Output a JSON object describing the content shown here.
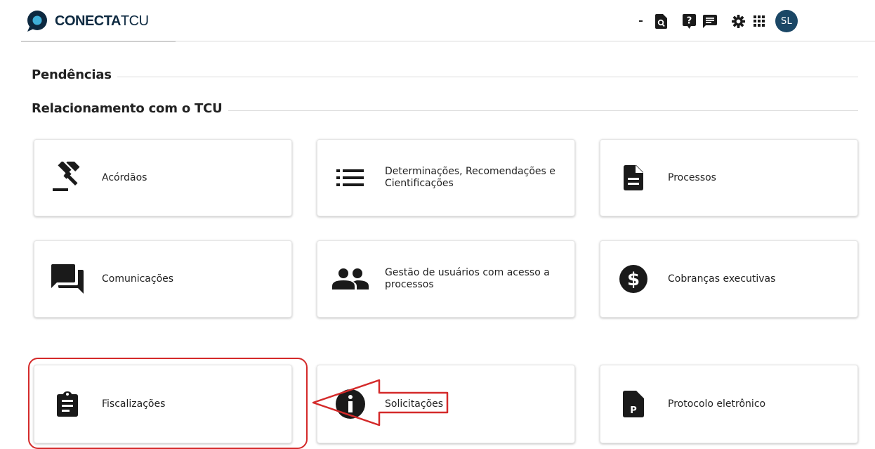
{
  "header": {
    "logo_bold": "CONECTA",
    "logo_light": "TCU",
    "avatar_initials": "SL"
  },
  "sections": {
    "pendencias": "Pendências",
    "relacionamento": "Relacionamento com o TCU"
  },
  "cards": [
    {
      "label": "Acórdãos",
      "icon": "gavel-icon"
    },
    {
      "label": "Determinações, Recomendações e Cientificações",
      "icon": "list-icon"
    },
    {
      "label": "Processos",
      "icon": "document-icon"
    },
    {
      "label": "Comunicações",
      "icon": "forum-icon"
    },
    {
      "label": "Gestão de usuários com acesso a processos",
      "icon": "people-icon"
    },
    {
      "label": "Cobranças executivas",
      "icon": "dollar-circle-icon"
    },
    {
      "label": "Fiscalizações",
      "icon": "clipboard-icon"
    },
    {
      "label": "Solicitações",
      "icon": "info-icon"
    },
    {
      "label": "Protocolo eletrônico",
      "icon": "protocol-file-icon"
    }
  ],
  "colors": {
    "avatar_bg": "#1b4766",
    "highlight": "#d42a2a",
    "logo_blue": "#0d2940"
  }
}
